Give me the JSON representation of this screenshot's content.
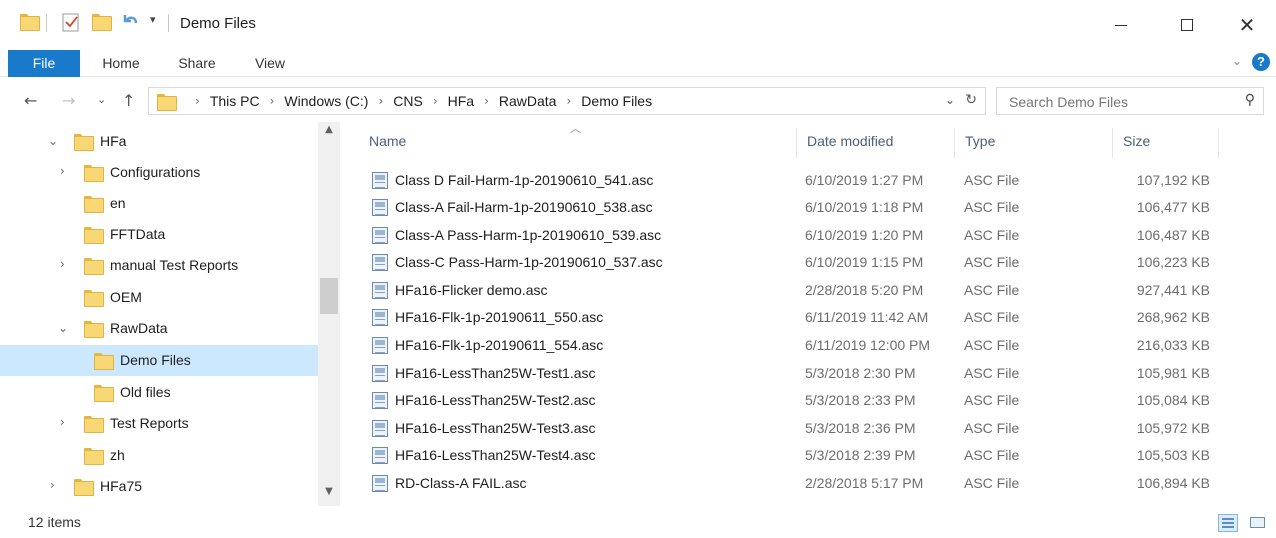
{
  "window": {
    "title": "Demo Files",
    "controls": {
      "minimize": "minimize",
      "maximize": "maximize",
      "close": "close"
    }
  },
  "ribbon": {
    "tabs": [
      "File",
      "Home",
      "Share",
      "View"
    ],
    "help": "?"
  },
  "address": {
    "segments": [
      "This PC",
      "Windows (C:)",
      "CNS",
      "HFa",
      "RawData",
      "Demo Files"
    ],
    "search_placeholder": "Search Demo Files"
  },
  "nav_tree": [
    {
      "label": "HFa",
      "level": 0,
      "expanded": true,
      "has_children": true
    },
    {
      "label": "Configurations",
      "level": 1,
      "expanded": false,
      "has_children": true
    },
    {
      "label": "en",
      "level": 1,
      "expanded": false,
      "has_children": false
    },
    {
      "label": "FFTData",
      "level": 1,
      "expanded": false,
      "has_children": false
    },
    {
      "label": "manual Test Reports",
      "level": 1,
      "expanded": false,
      "has_children": true
    },
    {
      "label": "OEM",
      "level": 1,
      "expanded": false,
      "has_children": false
    },
    {
      "label": "RawData",
      "level": 1,
      "expanded": true,
      "has_children": true
    },
    {
      "label": "Demo Files",
      "level": 2,
      "expanded": false,
      "has_children": false,
      "selected": true
    },
    {
      "label": "Old files",
      "level": 2,
      "expanded": false,
      "has_children": false
    },
    {
      "label": "Test Reports",
      "level": 1,
      "expanded": false,
      "has_children": true
    },
    {
      "label": "zh",
      "level": 1,
      "expanded": false,
      "has_children": false
    },
    {
      "label": "HFa75",
      "level": 0,
      "expanded": false,
      "has_children": true
    }
  ],
  "columns": {
    "name": "Name",
    "date": "Date modified",
    "type": "Type",
    "size": "Size"
  },
  "files": [
    {
      "name": "Class D Fail-Harm-1p-20190610_541.asc",
      "date": "6/10/2019 1:27 PM",
      "type": "ASC File",
      "size": "107,192 KB"
    },
    {
      "name": "Class-A Fail-Harm-1p-20190610_538.asc",
      "date": "6/10/2019 1:18 PM",
      "type": "ASC File",
      "size": "106,477 KB"
    },
    {
      "name": "Class-A Pass-Harm-1p-20190610_539.asc",
      "date": "6/10/2019 1:20 PM",
      "type": "ASC File",
      "size": "106,487 KB"
    },
    {
      "name": "Class-C Pass-Harm-1p-20190610_537.asc",
      "date": "6/10/2019 1:15 PM",
      "type": "ASC File",
      "size": "106,223 KB"
    },
    {
      "name": "HFa16-Flicker demo.asc",
      "date": "2/28/2018 5:20 PM",
      "type": "ASC File",
      "size": "927,441 KB"
    },
    {
      "name": "HFa16-Flk-1p-20190611_550.asc",
      "date": "6/11/2019 11:42 AM",
      "type": "ASC File",
      "size": "268,962 KB"
    },
    {
      "name": "HFa16-Flk-1p-20190611_554.asc",
      "date": "6/11/2019 12:00 PM",
      "type": "ASC File",
      "size": "216,033 KB"
    },
    {
      "name": "HFa16-LessThan25W-Test1.asc",
      "date": "5/3/2018 2:30 PM",
      "type": "ASC File",
      "size": "105,981 KB"
    },
    {
      "name": "HFa16-LessThan25W-Test2.asc",
      "date": "5/3/2018 2:33 PM",
      "type": "ASC File",
      "size": "105,084 KB"
    },
    {
      "name": "HFa16-LessThan25W-Test3.asc",
      "date": "5/3/2018 2:36 PM",
      "type": "ASC File",
      "size": "105,972 KB"
    },
    {
      "name": "HFa16-LessThan25W-Test4.asc",
      "date": "5/3/2018 2:39 PM",
      "type": "ASC File",
      "size": "105,503 KB"
    },
    {
      "name": "RD-Class-A FAIL.asc",
      "date": "2/28/2018 5:17 PM",
      "type": "ASC File",
      "size": "106,894 KB"
    }
  ],
  "status": {
    "item_count": "12 items"
  },
  "colors": {
    "accent": "#1979ca",
    "selected_bg": "#cce8ff",
    "folder": "#f8d775"
  }
}
